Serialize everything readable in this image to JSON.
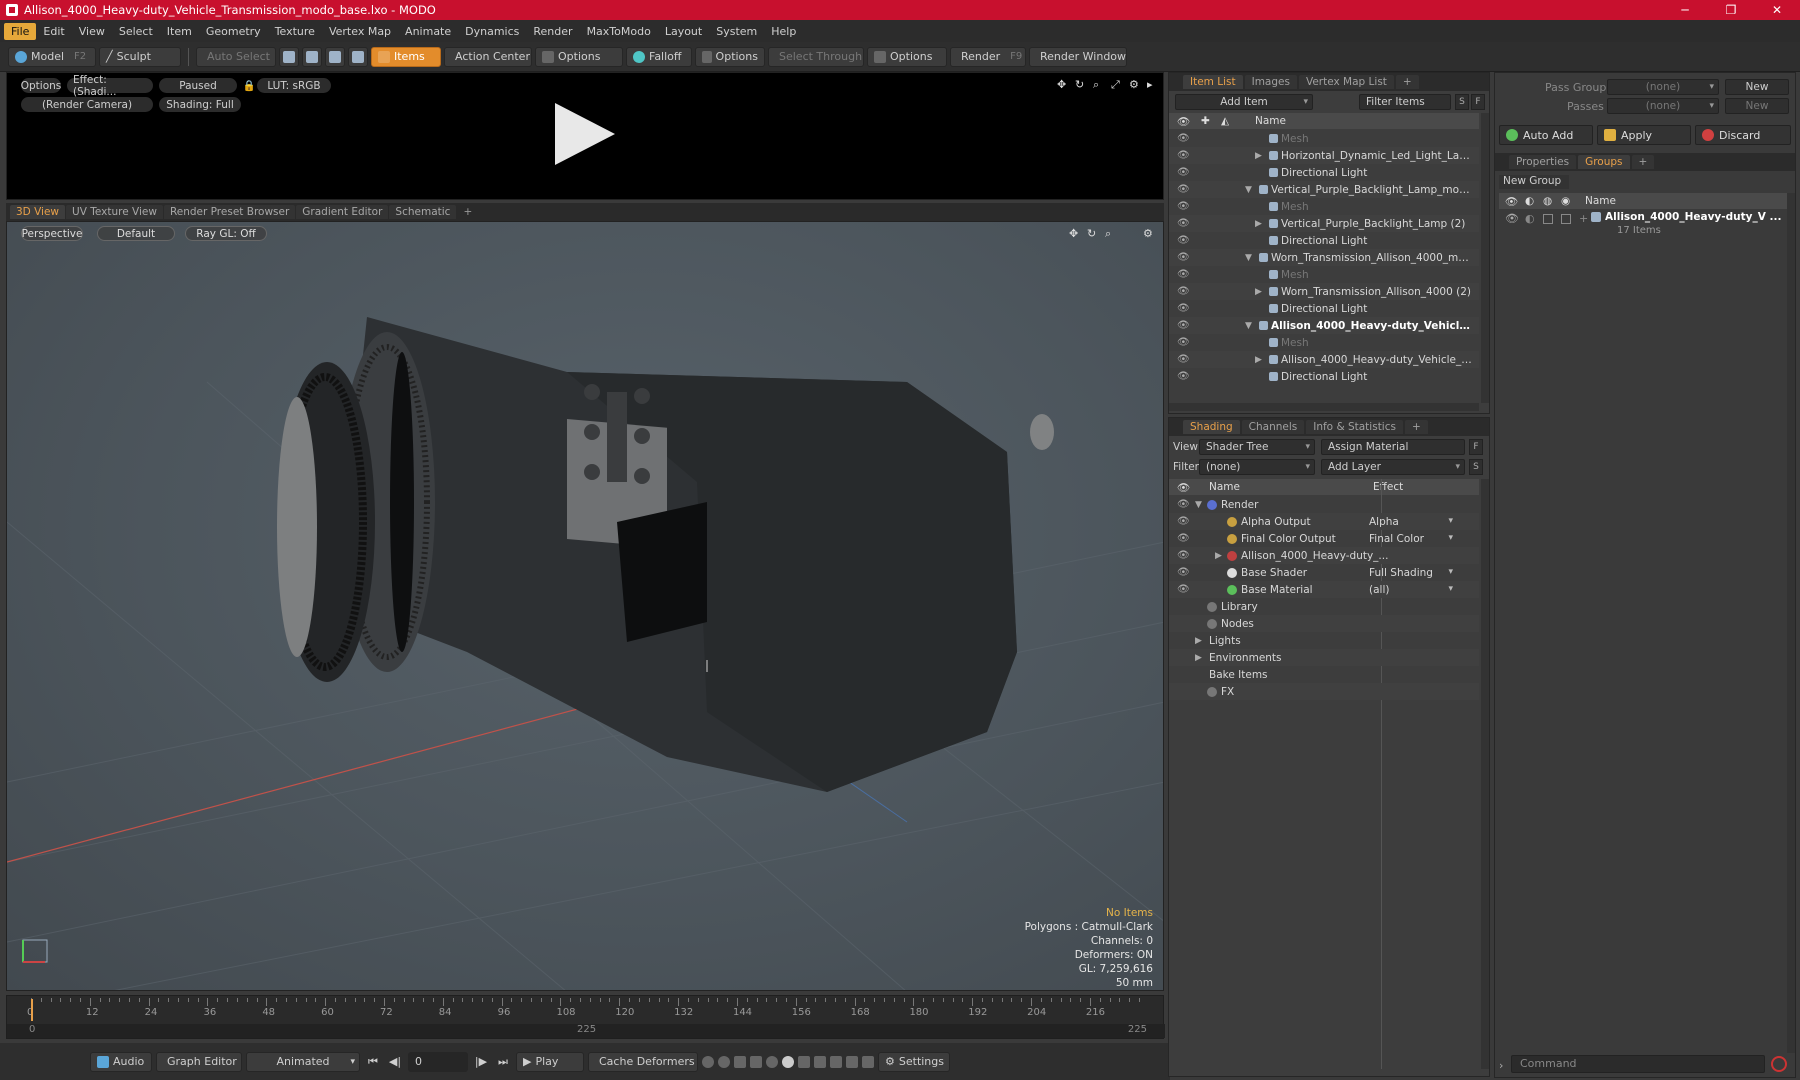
{
  "window": {
    "title": "Allison_4000_Heavy-duty_Vehicle_Transmission_modo_base.lxo - MODO",
    "minimize": "─",
    "maximize": "❐",
    "close": "✕"
  },
  "menu": [
    "File",
    "Edit",
    "View",
    "Select",
    "Item",
    "Geometry",
    "Texture",
    "Vertex Map",
    "Animate",
    "Dynamics",
    "Render",
    "MaxToModo",
    "Layout",
    "System",
    "Help"
  ],
  "toolbar": {
    "model": "Model",
    "model_key": "F2",
    "sculpt": "Sculpt",
    "auto_select": "Auto Select",
    "items": "Items",
    "action_center": "Action Center",
    "options1": "Options",
    "falloff": "Falloff",
    "options2": "Options",
    "select_through": "Select Through",
    "options3": "Options",
    "render": "Render",
    "render_key": "F9",
    "render_window": "Render Window"
  },
  "preview": {
    "options": "Options",
    "effect": "Effect: (Shadi...",
    "paused": "Paused",
    "lut": "LUT: sRGB",
    "camera": "(Render Camera)",
    "shading": "Shading: Full"
  },
  "viewport_tabs": [
    "3D View",
    "UV Texture View",
    "Render Preset Browser",
    "Gradient Editor",
    "Schematic",
    "+"
  ],
  "viewport": {
    "perspective": "Perspective",
    "default": "Default",
    "raygl": "Ray GL: Off",
    "stats": [
      "No Items",
      "Polygons : Catmull-Clark",
      "Channels: 0",
      "Deformers: ON",
      "GL: 7,259,616",
      "50 mm"
    ]
  },
  "timeline": {
    "ticks": [
      "0",
      "12",
      "24",
      "36",
      "48",
      "60",
      "72",
      "84",
      "96",
      "108",
      "120",
      "132",
      "144",
      "156",
      "168",
      "180",
      "192",
      "204",
      "216"
    ],
    "start": "0",
    "mid": "225",
    "end": "225"
  },
  "bottom": {
    "audio": "Audio",
    "graph_editor": "Graph Editor",
    "animated": "Animated",
    "frame": "0",
    "play": "Play",
    "cache": "Cache Deformers",
    "settings": "Settings"
  },
  "item_list": {
    "tabs": [
      "Item List",
      "Images",
      "Vertex Map List",
      "+"
    ],
    "add_item": "Add Item",
    "filter": "Filter Items",
    "s": "S",
    "f": "F",
    "col_name": "Name",
    "rows": [
      {
        "label": "Mesh",
        "indent": 3,
        "dim": true,
        "arrow": ""
      },
      {
        "label": "Horizontal_Dynamic_Led_Light_Lamp_...",
        "indent": 3,
        "arrow": "▶"
      },
      {
        "label": "Directional Light",
        "indent": 3,
        "arrow": ""
      },
      {
        "label": "Vertical_Purple_Backlight_Lamp_modo_b...",
        "indent": 2,
        "arrow": "▼"
      },
      {
        "label": "Mesh",
        "indent": 3,
        "dim": true,
        "arrow": ""
      },
      {
        "label": "Vertical_Purple_Backlight_Lamp (2)",
        "indent": 3,
        "arrow": "▶"
      },
      {
        "label": "Directional Light",
        "indent": 3,
        "arrow": ""
      },
      {
        "label": "Worn_Transmission_Allison_4000_modo ...",
        "indent": 2,
        "arrow": "▼"
      },
      {
        "label": "Mesh",
        "indent": 3,
        "dim": true,
        "arrow": ""
      },
      {
        "label": "Worn_Transmission_Allison_4000 (2)",
        "indent": 3,
        "arrow": "▶"
      },
      {
        "label": "Directional Light",
        "indent": 3,
        "arrow": ""
      },
      {
        "label": "Allison_4000_Heavy-duty_Vehicle...",
        "indent": 2,
        "bold": true,
        "arrow": "▼"
      },
      {
        "label": "Mesh",
        "indent": 3,
        "dim": true,
        "arrow": ""
      },
      {
        "label": "Allison_4000_Heavy-duty_Vehicle_Tra...",
        "indent": 3,
        "arrow": "▶"
      },
      {
        "label": "Directional Light",
        "indent": 3,
        "arrow": ""
      }
    ]
  },
  "shading": {
    "tabs": [
      "Shading",
      "Channels",
      "Info & Statistics",
      "+"
    ],
    "view_label": "View",
    "view_value": "Shader Tree",
    "assign": "Assign Material",
    "filter_label": "Filter",
    "filter_value": "(none)",
    "add_layer": "Add Layer",
    "col_name": "Name",
    "col_effect": "Effect",
    "rows": [
      {
        "label": "Render",
        "effect": "",
        "indent": 1,
        "arrow": "▼"
      },
      {
        "label": "Alpha Output",
        "effect": "Alpha",
        "indent": 2,
        "arrow": ""
      },
      {
        "label": "Final Color Output",
        "effect": "Final Color",
        "indent": 2,
        "arrow": ""
      },
      {
        "label": "Allison_4000_Heavy-duty_...",
        "effect": "",
        "indent": 2,
        "arrow": "▶"
      },
      {
        "label": "Base Shader",
        "effect": "Full Shading",
        "indent": 2,
        "arrow": ""
      },
      {
        "label": "Base Material",
        "effect": "(all)",
        "indent": 2,
        "arrow": ""
      },
      {
        "label": "Library",
        "effect": "",
        "indent": 1,
        "arrow": ""
      },
      {
        "label": "Nodes",
        "effect": "",
        "indent": 1,
        "arrow": ""
      },
      {
        "label": "Lights",
        "effect": "",
        "indent": 0,
        "arrow": "▶"
      },
      {
        "label": "Environments",
        "effect": "",
        "indent": 0,
        "arrow": "▶"
      },
      {
        "label": "Bake Items",
        "effect": "",
        "indent": 0,
        "arrow": ""
      },
      {
        "label": "FX",
        "effect": "",
        "indent": 1,
        "arrow": ""
      }
    ]
  },
  "groups_panel": {
    "pass_groups": "Pass Groups",
    "pass_value": "(none)",
    "new1": "New",
    "passes": "Passes",
    "passes_value": "(none)",
    "new2": "New",
    "auto_add": "Auto Add",
    "apply": "Apply",
    "discard": "Discard",
    "tabs": [
      "Properties",
      "Groups",
      "+"
    ],
    "new_group": "New Group",
    "col_name": "Name",
    "group_name": "Allison_4000_Heavy-duty_V ...",
    "group_count": "17 Items"
  },
  "command": {
    "placeholder": "Command"
  }
}
